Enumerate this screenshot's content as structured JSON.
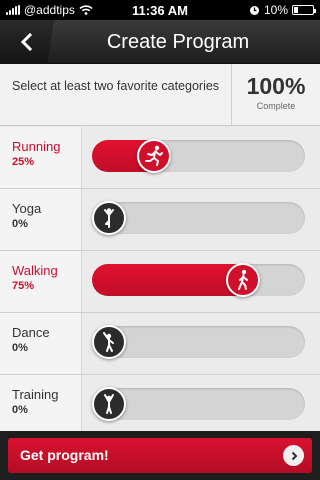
{
  "status_bar": {
    "carrier": "@addtips",
    "time": "11:36 AM",
    "battery": "10%"
  },
  "header": {
    "title": "Create Program",
    "back_icon": "chevron-left-icon"
  },
  "info": {
    "instruction": "Select at least two favorite categories",
    "percent": "100%",
    "percent_label": "Complete"
  },
  "categories": [
    {
      "name": "Running",
      "percent_text": "25%",
      "value": 0.25,
      "active": true,
      "icon": "running-icon"
    },
    {
      "name": "Yoga",
      "percent_text": "0%",
      "value": 0.0,
      "active": false,
      "icon": "yoga-icon"
    },
    {
      "name": "Walking",
      "percent_text": "75%",
      "value": 0.75,
      "active": true,
      "icon": "walking-icon"
    },
    {
      "name": "Dance",
      "percent_text": "0%",
      "value": 0.0,
      "active": false,
      "icon": "dance-icon"
    },
    {
      "name": "Training",
      "percent_text": "0%",
      "value": 0.0,
      "active": false,
      "icon": "training-icon"
    }
  ],
  "action": {
    "label": "Get program!",
    "icon": "chevron-right-icon"
  },
  "colors": {
    "accent": "#c8102e",
    "header_bg": "#2a2a2a",
    "track": "#d4d4d4"
  }
}
